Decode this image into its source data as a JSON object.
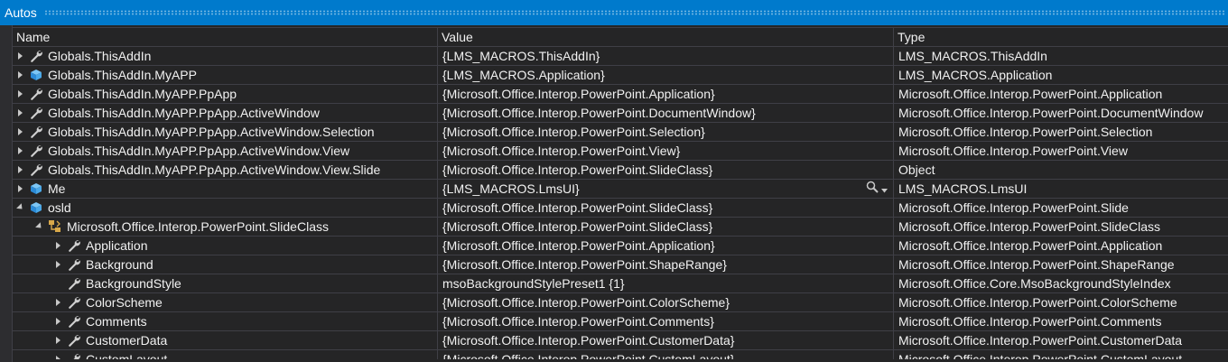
{
  "panel": {
    "title": "Autos"
  },
  "columns": {
    "name": "Name",
    "value": "Value",
    "type": "Type"
  },
  "rows": [
    {
      "level": 0,
      "expander": "collapsed",
      "icon": "wrench-icon",
      "name": "Globals.ThisAddIn",
      "value": "{LMS_MACROS.ThisAddIn}",
      "type": "LMS_MACROS.ThisAddIn"
    },
    {
      "level": 0,
      "expander": "collapsed",
      "icon": "cube-icon",
      "name": "Globals.ThisAddIn.MyAPP",
      "value": "{LMS_MACROS.Application}",
      "type": "LMS_MACROS.Application"
    },
    {
      "level": 0,
      "expander": "collapsed",
      "icon": "wrench-icon",
      "name": "Globals.ThisAddIn.MyAPP.PpApp",
      "value": "{Microsoft.Office.Interop.PowerPoint.Application}",
      "type": "Microsoft.Office.Interop.PowerPoint.Application"
    },
    {
      "level": 0,
      "expander": "collapsed",
      "icon": "wrench-icon",
      "name": "Globals.ThisAddIn.MyAPP.PpApp.ActiveWindow",
      "value": "{Microsoft.Office.Interop.PowerPoint.DocumentWindow}",
      "type": "Microsoft.Office.Interop.PowerPoint.DocumentWindow"
    },
    {
      "level": 0,
      "expander": "collapsed",
      "icon": "wrench-icon",
      "name": "Globals.ThisAddIn.MyAPP.PpApp.ActiveWindow.Selection",
      "value": "{Microsoft.Office.Interop.PowerPoint.Selection}",
      "type": "Microsoft.Office.Interop.PowerPoint.Selection"
    },
    {
      "level": 0,
      "expander": "collapsed",
      "icon": "wrench-icon",
      "name": "Globals.ThisAddIn.MyAPP.PpApp.ActiveWindow.View",
      "value": "{Microsoft.Office.Interop.PowerPoint.View}",
      "type": "Microsoft.Office.Interop.PowerPoint.View"
    },
    {
      "level": 0,
      "expander": "collapsed",
      "icon": "wrench-icon",
      "name": "Globals.ThisAddIn.MyAPP.PpApp.ActiveWindow.View.Slide",
      "value": "{Microsoft.Office.Interop.PowerPoint.SlideClass}",
      "type": "Object"
    },
    {
      "level": 0,
      "expander": "collapsed",
      "icon": "cube-icon",
      "name": "Me",
      "value": "{LMS_MACROS.LmsUI}",
      "type": "LMS_MACROS.LmsUI",
      "magnifier": true
    },
    {
      "level": 0,
      "expander": "expanded",
      "icon": "cube-icon",
      "name": "osld",
      "value": "{Microsoft.Office.Interop.PowerPoint.SlideClass}",
      "type": "Microsoft.Office.Interop.PowerPoint.Slide"
    },
    {
      "level": 1,
      "expander": "expanded",
      "icon": "class-icon",
      "name": "Microsoft.Office.Interop.PowerPoint.SlideClass",
      "value": "{Microsoft.Office.Interop.PowerPoint.SlideClass}",
      "type": "Microsoft.Office.Interop.PowerPoint.SlideClass"
    },
    {
      "level": 2,
      "expander": "collapsed",
      "icon": "wrench-icon",
      "name": "Application",
      "value": "{Microsoft.Office.Interop.PowerPoint.Application}",
      "type": "Microsoft.Office.Interop.PowerPoint.Application"
    },
    {
      "level": 2,
      "expander": "collapsed",
      "icon": "wrench-icon",
      "name": "Background",
      "value": "{Microsoft.Office.Interop.PowerPoint.ShapeRange}",
      "type": "Microsoft.Office.Interop.PowerPoint.ShapeRange"
    },
    {
      "level": 2,
      "expander": "none",
      "icon": "wrench-icon",
      "name": "BackgroundStyle",
      "value": "msoBackgroundStylePreset1 {1}",
      "type": "Microsoft.Office.Core.MsoBackgroundStyleIndex"
    },
    {
      "level": 2,
      "expander": "collapsed",
      "icon": "wrench-icon",
      "name": "ColorScheme",
      "value": "{Microsoft.Office.Interop.PowerPoint.ColorScheme}",
      "type": "Microsoft.Office.Interop.PowerPoint.ColorScheme"
    },
    {
      "level": 2,
      "expander": "collapsed",
      "icon": "wrench-icon",
      "name": "Comments",
      "value": "{Microsoft.Office.Interop.PowerPoint.Comments}",
      "type": "Microsoft.Office.Interop.PowerPoint.Comments"
    },
    {
      "level": 2,
      "expander": "collapsed",
      "icon": "wrench-icon",
      "name": "CustomerData",
      "value": "{Microsoft.Office.Interop.PowerPoint.CustomerData}",
      "type": "Microsoft.Office.Interop.PowerPoint.CustomerData"
    },
    {
      "level": 2,
      "expander": "collapsed",
      "icon": "wrench-icon",
      "name": "CustomLayout",
      "value": "{Microsoft.Office.Interop.PowerPoint.CustomLayout}",
      "type": "Microsoft.Office.Interop.PowerPoint.CustomLayout",
      "partial": true
    }
  ],
  "colors": {
    "accent": "#007acc",
    "background": "#252526",
    "gridline": "#3f3f46",
    "text": "#f1f1f1",
    "wrench": "#d0d0d0",
    "cube": "#4aa8e8",
    "class": "#d8a84a"
  }
}
